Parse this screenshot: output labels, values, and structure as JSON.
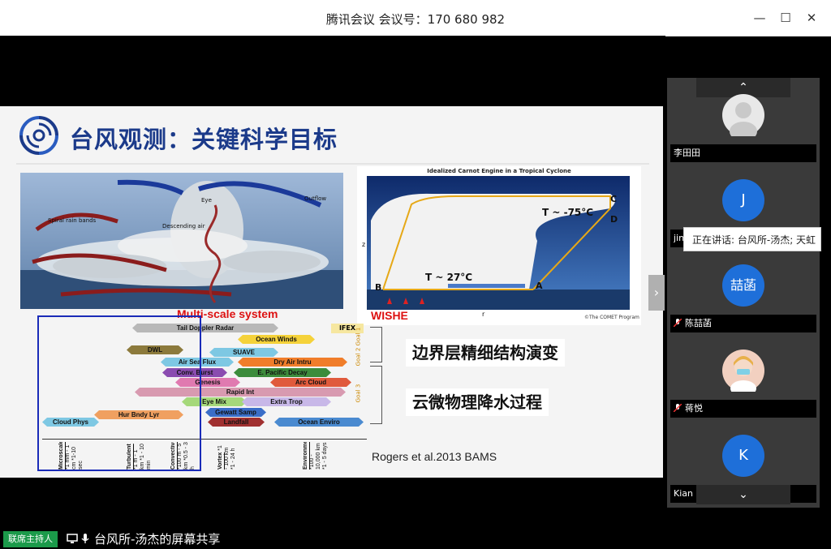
{
  "window": {
    "title": "腾讯会议 会议号：170 680 982"
  },
  "slide": {
    "title": "台风观测：关键科学目标",
    "label_multiscale": "Multi-scale system",
    "label_wishe": "WISHE",
    "carnot_title": "Idealized Carnot Engine in a Tropical Cyclone",
    "carnot_tc": "T  ~ -75°C",
    "carnot_tab": "T   ~ 27°C",
    "carnot_a": "A",
    "carnot_b": "B",
    "carnot_c": "C",
    "carnot_d": "D",
    "carnot_z": "z",
    "carnot_r": "r",
    "carnot_copy": "©The COMET Program",
    "cyclone_labels": {
      "spiral": "Spiral rain bands",
      "outflow": "Outflow",
      "eye": "Eye",
      "descending": "Descending air"
    },
    "goals_box_1": "边界层精细结构演变",
    "goals_box_2": "云微物理降水过程",
    "citation": "Rogers et al.2013 BAMS",
    "ifex": "IFEX",
    "goals": [
      "Goal 1",
      "Goal 2",
      "Goal 3"
    ],
    "scale_arrows": [
      {
        "label": "Tail Doppler Radar",
        "color": "#b8b8b8"
      },
      {
        "label": "Ocean Winds",
        "color": "#f5d23a"
      },
      {
        "label": "DWL",
        "color": "#8c7a3c"
      },
      {
        "label": "SUAVE",
        "color": "#7ec8e3"
      },
      {
        "label": "Air Sea Flux",
        "color": "#7ec8e3"
      },
      {
        "label": "Dry Air Intru",
        "color": "#f07d2a"
      },
      {
        "label": "Conv. Burst",
        "color": "#8a4cb0"
      },
      {
        "label": "E. Pacific Decay",
        "color": "#3c8c3c"
      },
      {
        "label": "Genesis",
        "color": "#e07ab0"
      },
      {
        "label": "Arc Cloud",
        "color": "#e05a3c"
      },
      {
        "label": "Rapid Int",
        "color": "#d89ab0"
      },
      {
        "label": "Eye Mix",
        "color": "#a5d87a"
      },
      {
        "label": "Extra Trop",
        "color": "#c8b8e8"
      },
      {
        "label": "Hur Bndy Lyr",
        "color": "#f0a060"
      },
      {
        "label": "Gewatt Samp",
        "color": "#3a6ec8"
      },
      {
        "label": "Cloud Phys",
        "color": "#7ec8e3"
      },
      {
        "label": "Landfall",
        "color": "#a03030"
      },
      {
        "label": "Ocean Enviro",
        "color": "#4a8ad0"
      }
    ],
    "scale_axis": [
      {
        "name": "Microscale",
        "sub": "*1 mm - 1 cm  *1-10 sec"
      },
      {
        "name": "Turbulent",
        "sub": "*1 m - 1 km  *1 - 10 min"
      },
      {
        "name": "Convective",
        "sub": "*100 m - 5 km  *0.5 - 3 h"
      },
      {
        "name": "Vortex",
        "sub": "*1 - 100 km  *1 - 24 h"
      },
      {
        "name": "Environmental",
        "sub": "*100 - 10,000 km  *1 - 5 days"
      }
    ]
  },
  "sidebar": {
    "participants": [
      {
        "name": "李田田",
        "initial": "",
        "avatar_color": "#e8e8e8",
        "mic": false
      },
      {
        "name": "jin",
        "initial": "J",
        "avatar_color": "#1e6fd9",
        "mic": false
      },
      {
        "name": "陈喆菡",
        "initial": "喆菡",
        "avatar_color": "#1e6fd9",
        "mic": true
      },
      {
        "name": "蒋悦",
        "initial": "",
        "avatar_color": "#f2d0c0",
        "mic": true
      },
      {
        "name": "Kian",
        "initial": "K",
        "avatar_color": "#1e6fd9",
        "mic": false
      }
    ],
    "speaking_tooltip": "正在讲话: 台风所-汤杰; 天虹"
  },
  "footer": {
    "host_badge": "联席主持人",
    "share_text": "台风所-汤杰的屏幕共享"
  }
}
